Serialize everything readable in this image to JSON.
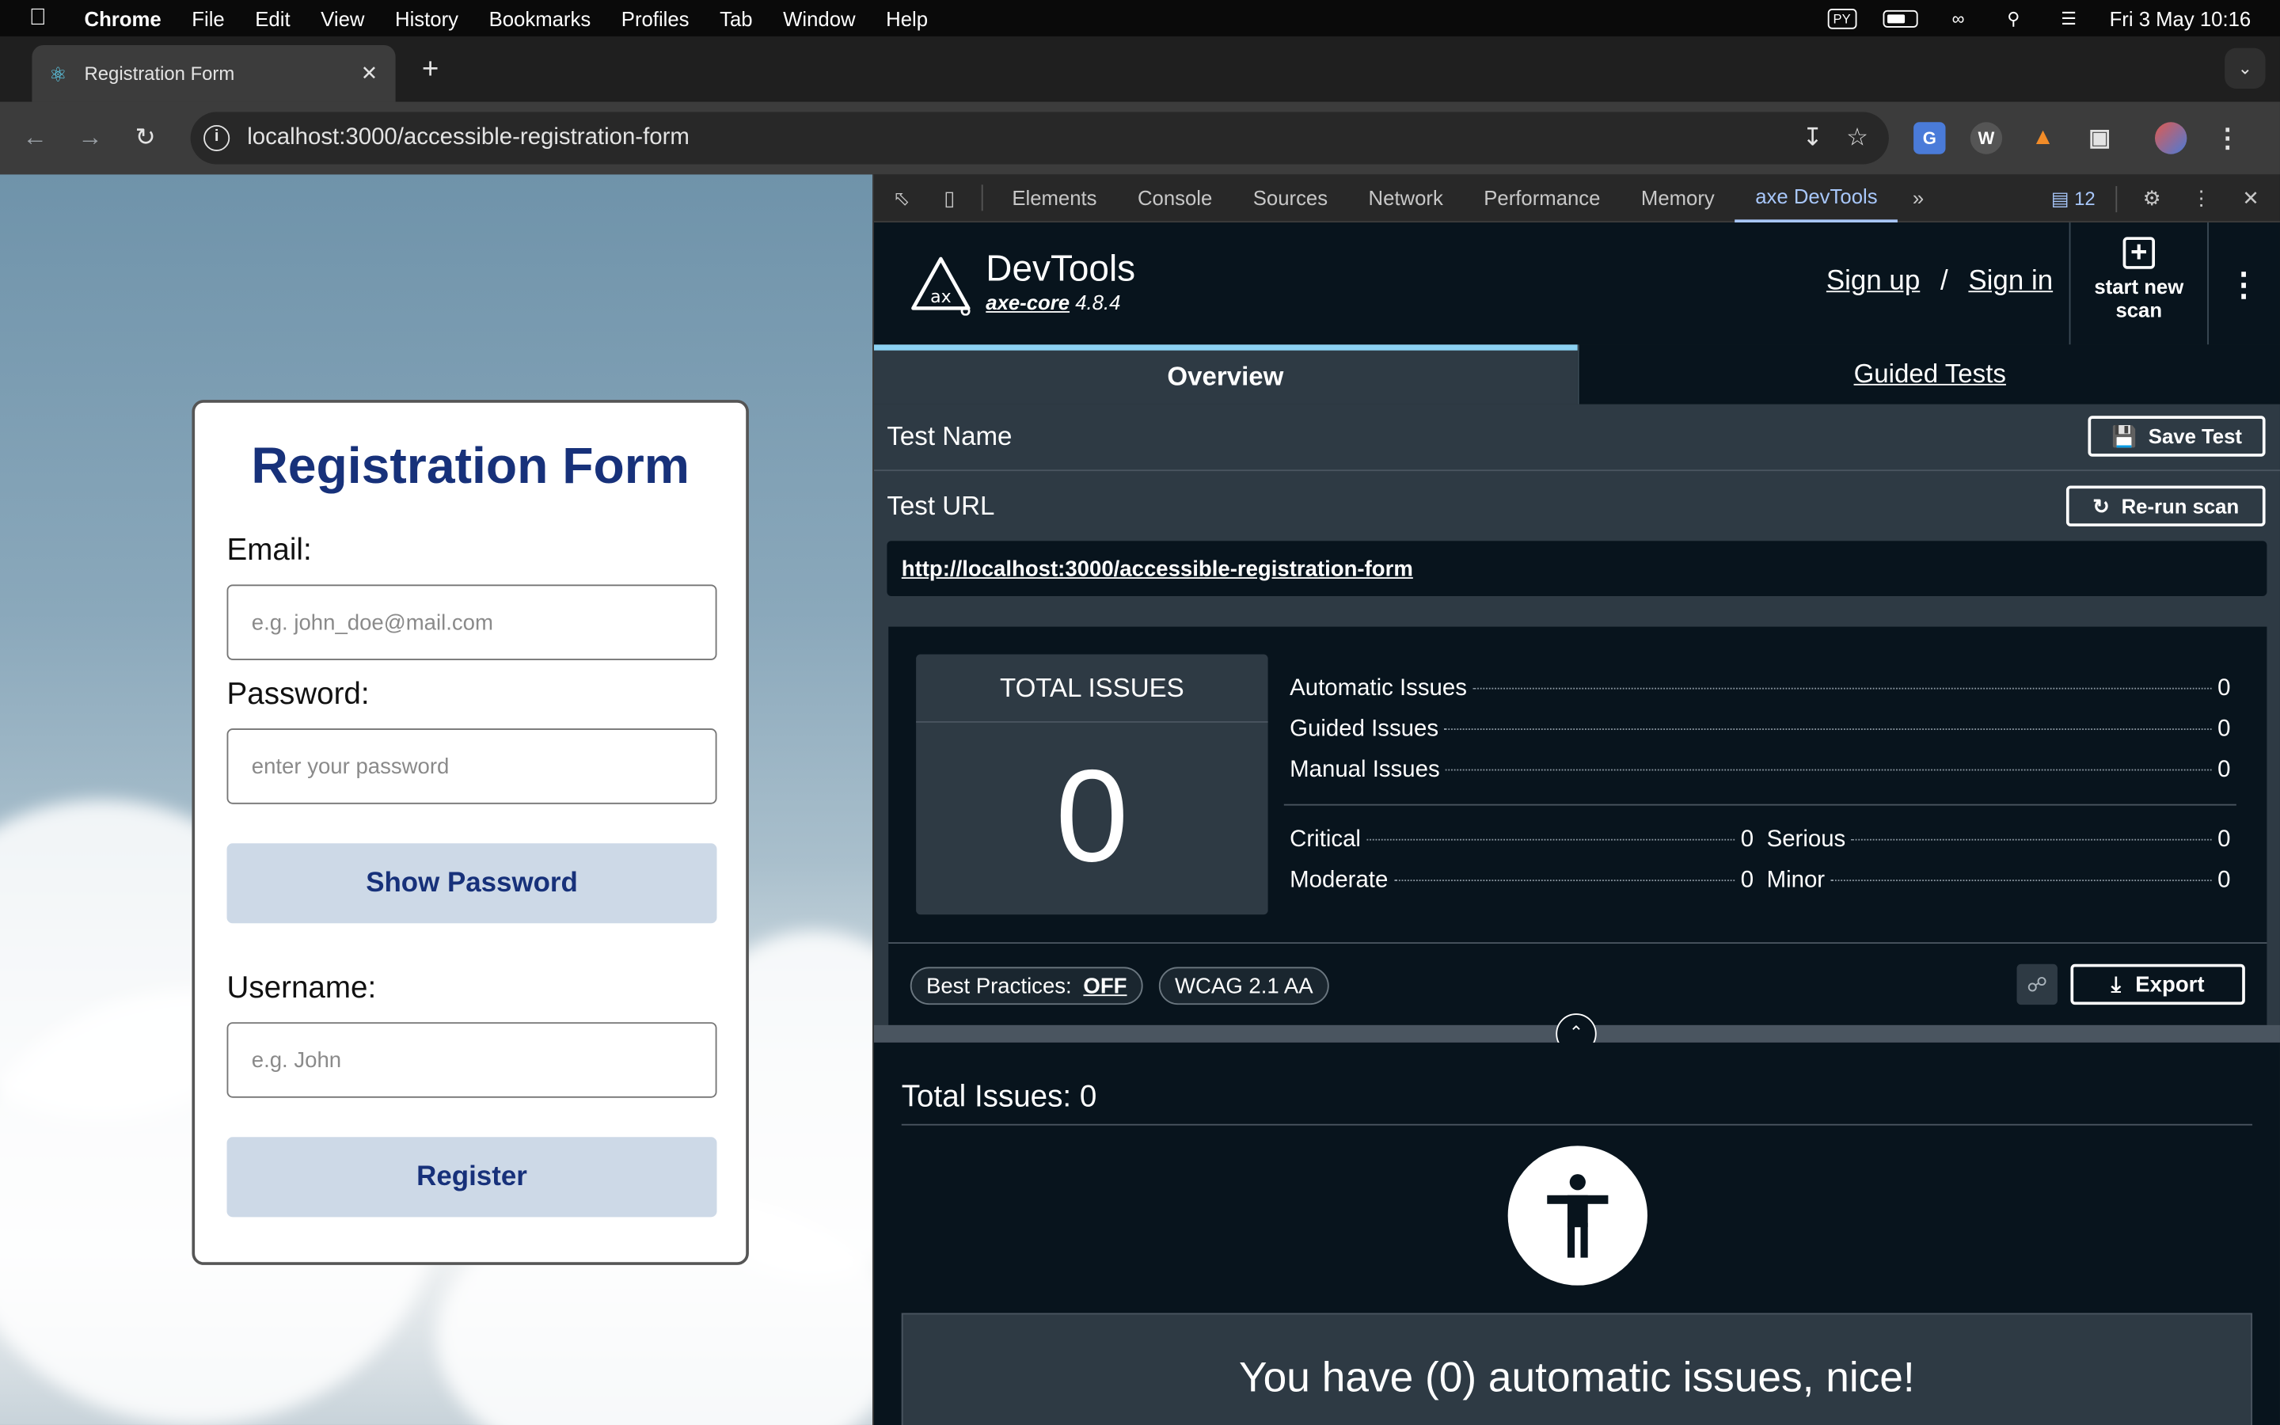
{
  "menubar": {
    "items": [
      "Chrome",
      "File",
      "Edit",
      "View",
      "History",
      "Bookmarks",
      "Profiles",
      "Tab",
      "Window",
      "Help"
    ],
    "py_label": "PY",
    "datetime": "Fri 3 May  10:16"
  },
  "browser": {
    "tab_title": "Registration Form",
    "url": "localhost:3000/accessible-registration-form"
  },
  "form": {
    "title": "Registration Form",
    "email_label": "Email:",
    "email_placeholder": "e.g. john_doe@mail.com",
    "password_label": "Password:",
    "password_placeholder": "enter your password",
    "show_password_label": "Show Password",
    "username_label": "Username:",
    "username_placeholder": "e.g. John",
    "register_label": "Register"
  },
  "devtools": {
    "tabs": [
      "Elements",
      "Console",
      "Sources",
      "Network",
      "Performance",
      "Memory",
      "axe DevTools"
    ],
    "active_tab": "axe DevTools",
    "issues_badge": "12"
  },
  "axe": {
    "title": "DevTools",
    "core_name": "axe-core",
    "core_version": "4.8.4",
    "sign_up": "Sign up",
    "separator": "/",
    "sign_in": "Sign in",
    "new_scan_label": "start new scan",
    "tab_overview": "Overview",
    "tab_guided": "Guided Tests",
    "test_name_label": "Test Name",
    "save_test_label": "Save Test",
    "test_url_label": "Test URL",
    "rerun_label": "Re-run scan",
    "test_url": "http://localhost:3000/accessible-registration-form",
    "total_issues_heading": "TOTAL ISSUES",
    "total_issues_value": "0",
    "automatic_label": "Automatic Issues",
    "automatic_value": "0",
    "guided_label": "Guided Issues",
    "guided_value": "0",
    "manual_label": "Manual Issues",
    "manual_value": "0",
    "critical_label": "Critical",
    "critical_value": "0",
    "serious_label": "Serious",
    "serious_value": "0",
    "moderate_label": "Moderate",
    "moderate_value": "0",
    "minor_label": "Minor",
    "minor_value": "0",
    "best_practices_label": "Best Practices:",
    "best_practices_value": "OFF",
    "standard_label": "WCAG 2.1 AA",
    "export_label": "Export",
    "results_title": "Total Issues: 0",
    "nice_message": "You have (0) automatic issues, nice!"
  },
  "colors": {
    "form_title": "#17317a",
    "axe_dark": "#08141d",
    "axe_panel": "#2e3a44",
    "overview_accent": "#8bd1f2",
    "devtools_active": "#a8c7fa"
  }
}
